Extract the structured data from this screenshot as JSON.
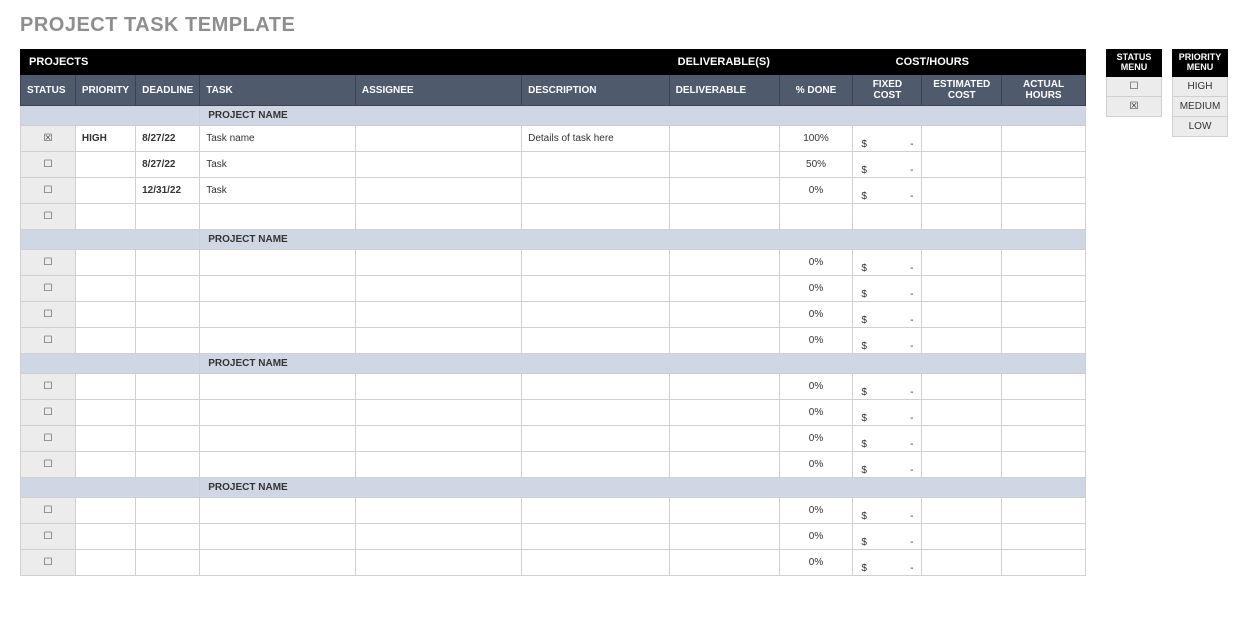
{
  "title": "PROJECT TASK TEMPLATE",
  "groups": {
    "g1": "PROJECTS",
    "g2": "DELIVERABLE(S)",
    "g3": "COST/HOURS"
  },
  "cols": {
    "status": "STATUS",
    "priority": "PRIORITY",
    "deadline": "DEADLINE",
    "task": "TASK",
    "assignee": "ASSIGNEE",
    "description": "DESCRIPTION",
    "deliverable": "DELIVERABLE",
    "done": "% DONE",
    "fixed": "FIXED COST",
    "estimated": "ESTIMATED COST",
    "actual": "ACTUAL HOURS"
  },
  "projectLabel": "PROJECT NAME",
  "sym": {
    "dollar": "$",
    "dash": "-",
    "unchecked": "☐",
    "checked": "☒"
  },
  "projects": [
    {
      "rows": [
        {
          "status": "checked",
          "priority": "HIGH",
          "deadline": "8/27/22",
          "task": "Task name",
          "assignee": "",
          "description": "Details of task here",
          "deliverable": "",
          "done": "100%",
          "fixed": true,
          "estimated": "",
          "actual": ""
        },
        {
          "status": "unchecked",
          "priority": "",
          "deadline": "8/27/22",
          "task": "Task",
          "assignee": "",
          "description": "",
          "deliverable": "",
          "done": "50%",
          "fixed": true,
          "estimated": "",
          "actual": ""
        },
        {
          "status": "unchecked",
          "priority": "",
          "deadline": "12/31/22",
          "task": "Task",
          "assignee": "",
          "description": "",
          "deliverable": "",
          "done": "0%",
          "fixed": true,
          "estimated": "",
          "actual": ""
        },
        {
          "status": "unchecked",
          "priority": "",
          "deadline": "",
          "task": "",
          "assignee": "",
          "description": "",
          "deliverable": "",
          "done": "",
          "fixed": false,
          "estimated": "",
          "actual": ""
        }
      ]
    },
    {
      "rows": [
        {
          "status": "unchecked",
          "priority": "",
          "deadline": "",
          "task": "",
          "assignee": "",
          "description": "",
          "deliverable": "",
          "done": "0%",
          "fixed": true,
          "estimated": "",
          "actual": ""
        },
        {
          "status": "unchecked",
          "priority": "",
          "deadline": "",
          "task": "",
          "assignee": "",
          "description": "",
          "deliverable": "",
          "done": "0%",
          "fixed": true,
          "estimated": "",
          "actual": ""
        },
        {
          "status": "unchecked",
          "priority": "",
          "deadline": "",
          "task": "",
          "assignee": "",
          "description": "",
          "deliverable": "",
          "done": "0%",
          "fixed": true,
          "estimated": "",
          "actual": ""
        },
        {
          "status": "unchecked",
          "priority": "",
          "deadline": "",
          "task": "",
          "assignee": "",
          "description": "",
          "deliverable": "",
          "done": "0%",
          "fixed": true,
          "estimated": "",
          "actual": ""
        }
      ]
    },
    {
      "rows": [
        {
          "status": "unchecked",
          "priority": "",
          "deadline": "",
          "task": "",
          "assignee": "",
          "description": "",
          "deliverable": "",
          "done": "0%",
          "fixed": true,
          "estimated": "",
          "actual": ""
        },
        {
          "status": "unchecked",
          "priority": "",
          "deadline": "",
          "task": "",
          "assignee": "",
          "description": "",
          "deliverable": "",
          "done": "0%",
          "fixed": true,
          "estimated": "",
          "actual": ""
        },
        {
          "status": "unchecked",
          "priority": "",
          "deadline": "",
          "task": "",
          "assignee": "",
          "description": "",
          "deliverable": "",
          "done": "0%",
          "fixed": true,
          "estimated": "",
          "actual": ""
        },
        {
          "status": "unchecked",
          "priority": "",
          "deadline": "",
          "task": "",
          "assignee": "",
          "description": "",
          "deliverable": "",
          "done": "0%",
          "fixed": true,
          "estimated": "",
          "actual": ""
        }
      ]
    },
    {
      "rows": [
        {
          "status": "unchecked",
          "priority": "",
          "deadline": "",
          "task": "",
          "assignee": "",
          "description": "",
          "deliverable": "",
          "done": "0%",
          "fixed": true,
          "estimated": "",
          "actual": ""
        },
        {
          "status": "unchecked",
          "priority": "",
          "deadline": "",
          "task": "",
          "assignee": "",
          "description": "",
          "deliverable": "",
          "done": "0%",
          "fixed": true,
          "estimated": "",
          "actual": ""
        },
        {
          "status": "unchecked",
          "priority": "",
          "deadline": "",
          "task": "",
          "assignee": "",
          "description": "",
          "deliverable": "",
          "done": "0%",
          "fixed": true,
          "estimated": "",
          "actual": ""
        }
      ]
    }
  ],
  "statusMenu": {
    "title": "STATUS MENU",
    "items": [
      "☐",
      "☒"
    ]
  },
  "priorityMenu": {
    "title": "PRIORITY MENU",
    "items": [
      "HIGH",
      "MEDIUM",
      "LOW"
    ]
  }
}
